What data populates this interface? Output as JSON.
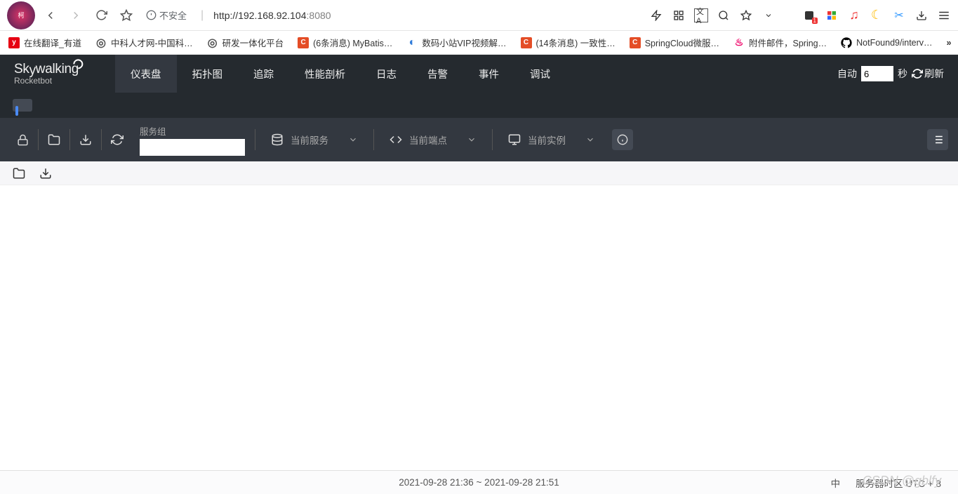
{
  "browser": {
    "security_label": "不安全",
    "url_host": "http://192.168.92.104",
    "url_port": ":8080"
  },
  "bookmarks": [
    {
      "label": "在线翻译_有道",
      "color": "#e60012",
      "glyph": "y"
    },
    {
      "label": "中科人才网-中国科…",
      "color": "#555",
      "glyph": "◎"
    },
    {
      "label": "研发一体化平台",
      "color": "#555",
      "glyph": "◎"
    },
    {
      "label": "(6条消息) MyBatis…",
      "color": "#e44d26",
      "glyph": "C"
    },
    {
      "label": "数码小站VIP视频解…",
      "color": "#2f7bd9",
      "glyph": "◐"
    },
    {
      "label": "(14条消息) 一致性…",
      "color": "#e44d26",
      "glyph": "C"
    },
    {
      "label": "SpringCloud微服…",
      "color": "#e44d26",
      "glyph": "C"
    },
    {
      "label": "附件邮件，Spring…",
      "color": "#e06",
      "glyph": "▲"
    },
    {
      "label": "NotFound9/interv…",
      "color": "#000",
      "glyph": ""
    }
  ],
  "brand": {
    "name": "Skywalking",
    "sub": "Rocketbot"
  },
  "nav": {
    "items": [
      "仪表盘",
      "拓扑图",
      "追踪",
      "性能剖析",
      "日志",
      "告警",
      "事件",
      "调试"
    ],
    "active": 0
  },
  "refresh": {
    "auto_label": "自动",
    "value": "6",
    "unit": "秒",
    "button": "刷新"
  },
  "selectors": {
    "service_group_label": "服务组",
    "current_service": "当前服务",
    "current_endpoint": "当前端点",
    "current_instance": "当前实例"
  },
  "footer": {
    "range": "2021-09-28 21:36 ~ 2021-09-28 21:51",
    "lang": "中",
    "tz_label": "服务器时区  UTC + 8"
  },
  "watermark": "CSDN @gblfy"
}
